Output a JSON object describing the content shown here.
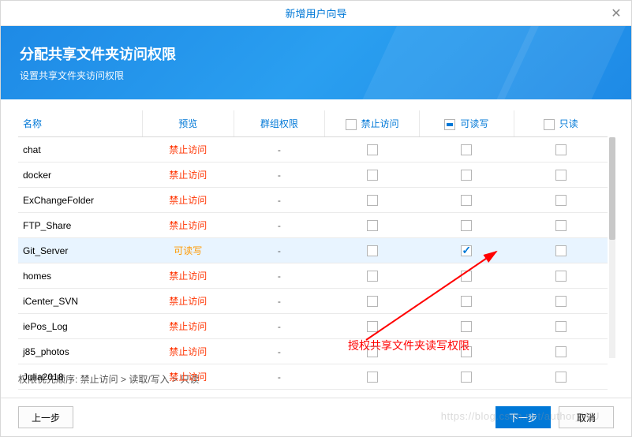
{
  "title": "新增用户向导",
  "banner": {
    "heading": "分配共享文件夹访问权限",
    "sub": "设置共享文件夹访问权限"
  },
  "columns": {
    "name": "名称",
    "preview": "预览",
    "groupPerm": "群组权限",
    "deny": "禁止访问",
    "rw": "可读写",
    "ro": "只读"
  },
  "previewLabels": {
    "deny": "禁止访问",
    "rw": "可读写"
  },
  "rows": [
    {
      "name": "chat",
      "preview": "deny",
      "group": "-",
      "rw": false,
      "selected": false
    },
    {
      "name": "docker",
      "preview": "deny",
      "group": "-",
      "rw": false,
      "selected": false
    },
    {
      "name": "ExChangeFolder",
      "preview": "deny",
      "group": "-",
      "rw": false,
      "selected": false
    },
    {
      "name": "FTP_Share",
      "preview": "deny",
      "group": "-",
      "rw": false,
      "selected": false
    },
    {
      "name": "Git_Server",
      "preview": "rw",
      "group": "-",
      "rw": true,
      "selected": true
    },
    {
      "name": "homes",
      "preview": "deny",
      "group": "-",
      "rw": false,
      "selected": false
    },
    {
      "name": "iCenter_SVN",
      "preview": "deny",
      "group": "-",
      "rw": false,
      "selected": false
    },
    {
      "name": "iePos_Log",
      "preview": "deny",
      "group": "-",
      "rw": false,
      "selected": false
    },
    {
      "name": "j85_photos",
      "preview": "deny",
      "group": "-",
      "rw": false,
      "selected": false
    },
    {
      "name": "Julia2018",
      "preview": "deny",
      "group": "-",
      "rw": false,
      "selected": false
    }
  ],
  "priority": "权限优先顺序: 禁止访问 > 读取/写入 > 只读",
  "buttons": {
    "prev": "上一步",
    "next": "下一步",
    "cancel": "取消"
  },
  "annotation": "授权共享文件夹读写权限",
  "watermark": "https://blog.csdn.net/author_WU"
}
